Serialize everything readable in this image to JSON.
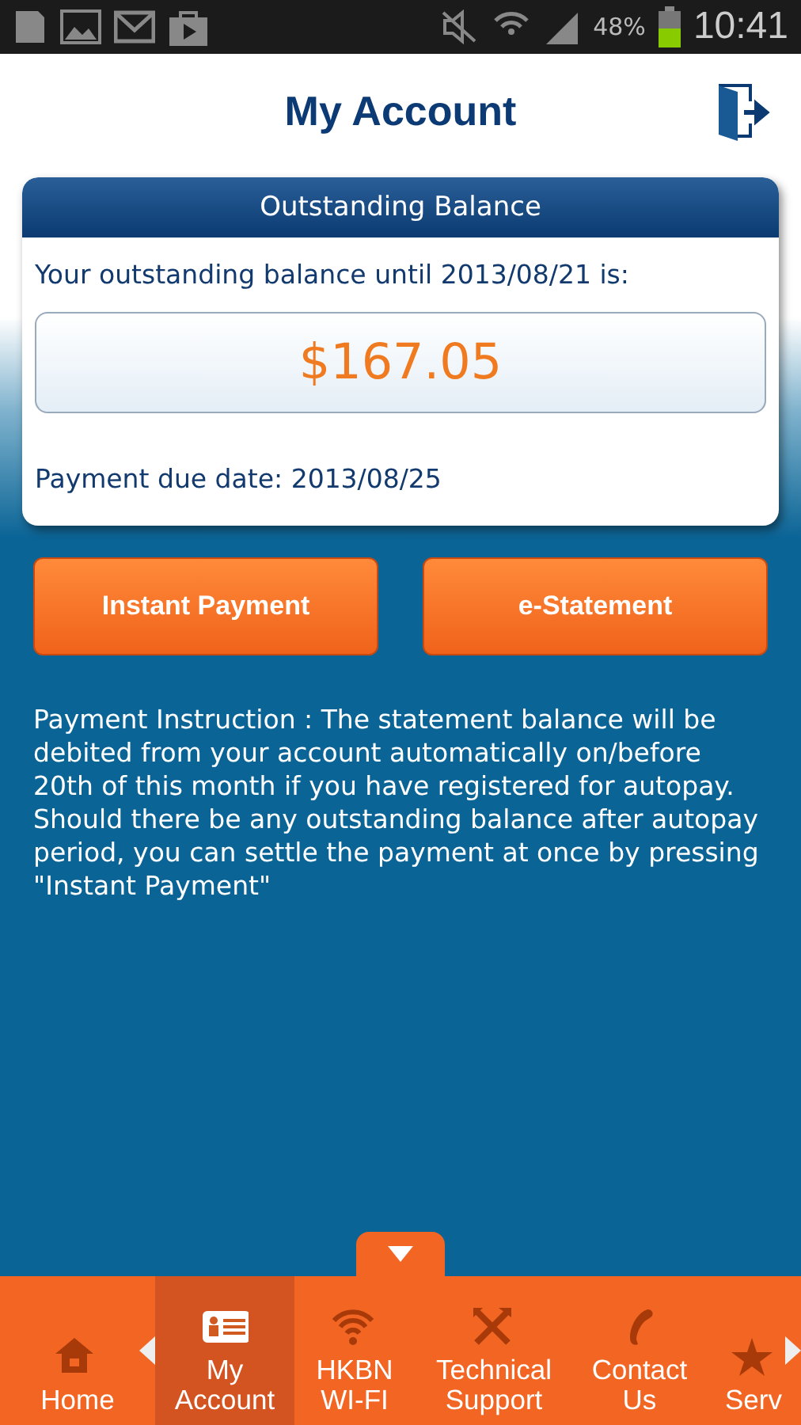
{
  "status_bar": {
    "battery": "48%",
    "time": "10:41"
  },
  "header": {
    "title": "My Account"
  },
  "balance_card": {
    "title": "Outstanding Balance",
    "label": "Your outstanding balance until 2013/08/21 is:",
    "amount": "$167.05",
    "due": "Payment due date: 2013/08/25"
  },
  "buttons": [
    "Instant Payment",
    "e-Statement"
  ],
  "instruction": "Payment Instruction : The statement balance will be debited from your account automatically on/before 20th of this month if you have registered for autopay. Should there be any outstanding balance after autopay period, you can settle the payment at once by pressing \"Instant Payment\"",
  "nav": [
    {
      "kind": "home",
      "label": "Home",
      "selected": false
    },
    {
      "kind": "account",
      "label": "My Account",
      "selected": true
    },
    {
      "kind": "wifi",
      "label": "HKBN WI-FI",
      "selected": false
    },
    {
      "kind": "tools",
      "label": "Technical Support",
      "selected": false
    },
    {
      "kind": "phone",
      "label": "Contact Us",
      "selected": false
    },
    {
      "kind": "star",
      "label": "Serv",
      "selected": false
    }
  ]
}
